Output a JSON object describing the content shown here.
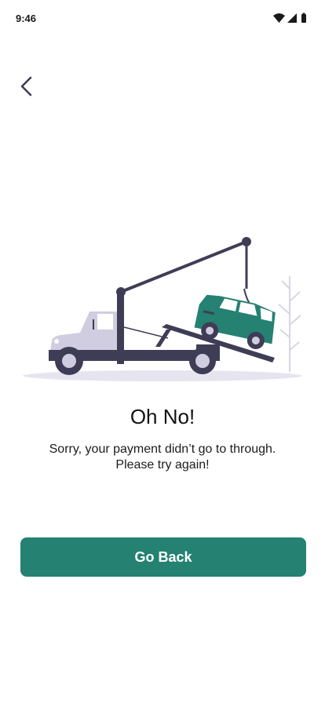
{
  "status_bar": {
    "time": "9:46",
    "icons": [
      "wifi-icon",
      "cellular-signal-icon",
      "battery-icon"
    ]
  },
  "nav": {
    "back_icon": "chevron-left-icon"
  },
  "illustration": {
    "subject": "tow-truck-lifting-car",
    "colors": {
      "truck_dark": "#3f3d56",
      "truck_light": "#d0cde1",
      "car": "#258172",
      "ground": "#e6e5ef",
      "tree": "#d8d6e4"
    }
  },
  "content": {
    "title": "Oh No!",
    "message_line1": "Sorry, your payment didn’t go to through.",
    "message_line2": "Please try again!"
  },
  "actions": {
    "go_back_label": "Go Back"
  },
  "theme": {
    "accent": "#258172",
    "text": "#111111",
    "background": "#ffffff"
  }
}
